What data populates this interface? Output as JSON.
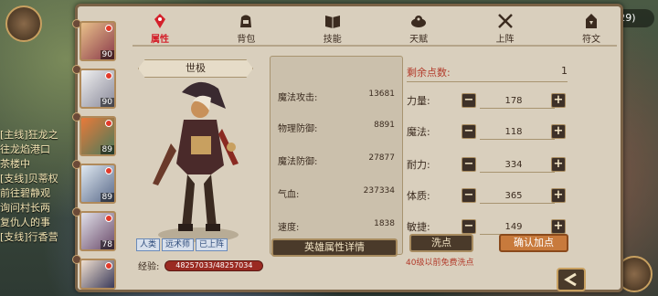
{
  "background": {
    "coords": "(58,129)",
    "side_text": [
      "[主线]狂龙之",
      "往龙焰港口",
      "茶楼中",
      "[支线]贝蒂权",
      "前往碧静观",
      "询问村长两",
      "复仇人的事",
      "[支线]行香营"
    ]
  },
  "tabs": [
    {
      "label": "属性",
      "icon": "attribute-icon",
      "active": true
    },
    {
      "label": "背包",
      "icon": "backpack-icon",
      "active": false
    },
    {
      "label": "技能",
      "icon": "skill-book-icon",
      "active": false
    },
    {
      "label": "天赋",
      "icon": "talent-icon",
      "active": false
    },
    {
      "label": "上阵",
      "icon": "crossed-swords-icon",
      "active": false
    },
    {
      "label": "符文",
      "icon": "rune-icon",
      "active": false
    }
  ],
  "heroes": [
    {
      "level": "90",
      "badge": true
    },
    {
      "level": "90",
      "badge": true
    },
    {
      "level": "89",
      "badge": true
    },
    {
      "level": "89",
      "badge": true
    },
    {
      "level": "78",
      "badge": true
    },
    {
      "level": "",
      "badge": true
    }
  ],
  "hero": {
    "title": "世极",
    "tags": [
      "人类",
      "远术师",
      "已上阵"
    ],
    "exp_label": "经验:",
    "exp_value": "48257033/48257034"
  },
  "stats": {
    "rows": [
      {
        "label": "魔法攻击:",
        "value": "13681"
      },
      {
        "label": "物理防御:",
        "value": "8891"
      },
      {
        "label": "魔法防御:",
        "value": "27877"
      },
      {
        "label": "气血:",
        "value": "237334"
      },
      {
        "label": "速度:",
        "value": "1838"
      }
    ],
    "detail_button": "英雄属性详情"
  },
  "attributes": {
    "remaining_label": "剩余点数:",
    "remaining_value": "1",
    "rows": [
      {
        "label": "力量:",
        "value": "178"
      },
      {
        "label": "魔法:",
        "value": "118"
      },
      {
        "label": "耐力:",
        "value": "334"
      },
      {
        "label": "体质:",
        "value": "365"
      },
      {
        "label": "敏捷:",
        "value": "149"
      }
    ],
    "minus": "−",
    "plus": "+",
    "reset_button": "洗点",
    "confirm_button": "确认加点",
    "free_note": "40级以前免费洗点"
  },
  "colors": {
    "accent_red": "#b23a2a",
    "panel_bg": "#d9cfbd",
    "button_dark": "#4a3a2a",
    "button_orange": "#c87a3c"
  }
}
